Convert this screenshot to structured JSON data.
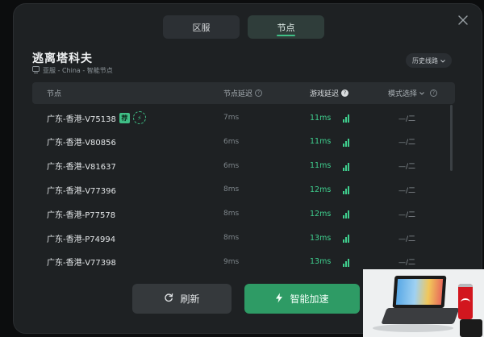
{
  "tabs": [
    {
      "label": "区服",
      "active": false
    },
    {
      "label": "节点",
      "active": true
    }
  ],
  "game": {
    "title": "逃离塔科夫",
    "region": "亚服 - China - 智能节点"
  },
  "history_label": "历史线路",
  "table": {
    "columns": {
      "node": "节点",
      "node_latency": "节点延迟",
      "game_latency": "游戏延迟",
      "mode": "模式选择"
    },
    "rows": [
      {
        "name": "广东-香港-V75138",
        "tag": "荐",
        "node_latency": "7ms",
        "game_latency": "11ms",
        "signal_level": 3,
        "mode": "—/二"
      },
      {
        "name": "广东-香港-V80856",
        "node_latency": "6ms",
        "game_latency": "11ms",
        "signal_level": 3,
        "mode": "—/二"
      },
      {
        "name": "广东-香港-V81637",
        "node_latency": "6ms",
        "game_latency": "11ms",
        "signal_level": 3,
        "mode": "—/二"
      },
      {
        "name": "广东-香港-V77396",
        "node_latency": "8ms",
        "game_latency": "12ms",
        "signal_level": 3,
        "mode": "—/二"
      },
      {
        "name": "广东-香港-P77578",
        "node_latency": "8ms",
        "game_latency": "12ms",
        "signal_level": 3,
        "mode": "—/二"
      },
      {
        "name": "广东-香港-P74994",
        "node_latency": "8ms",
        "game_latency": "13ms",
        "signal_level": 3,
        "mode": "—/二"
      },
      {
        "name": "广东-香港-V77398",
        "node_latency": "9ms",
        "game_latency": "13ms",
        "signal_level": 3,
        "mode": "—/二"
      }
    ]
  },
  "buttons": {
    "refresh": "刷新",
    "boost": "智能加速"
  },
  "colors": {
    "accent": "#3fcf8e",
    "panel": "#1e2123",
    "boost_button": "#2e9b65"
  }
}
